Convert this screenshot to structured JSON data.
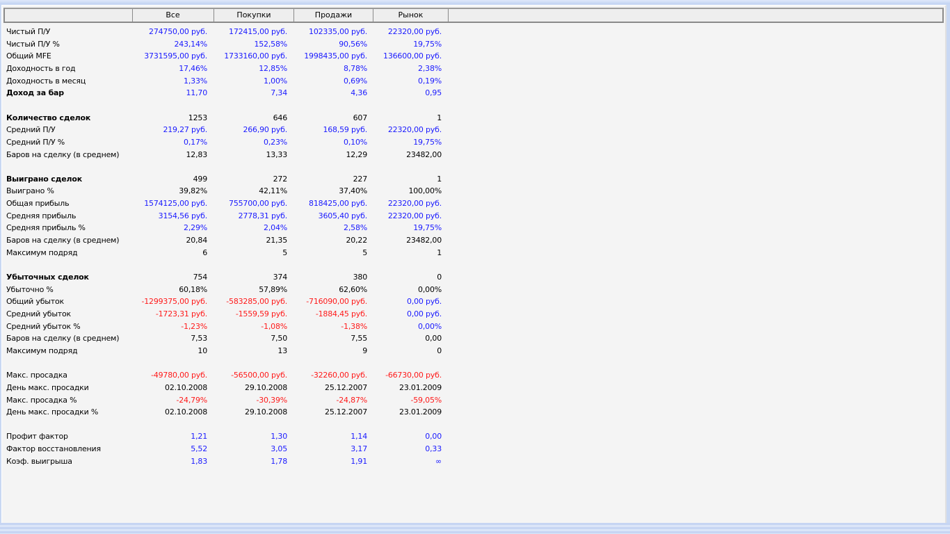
{
  "columns": [
    "Все",
    "Покупки",
    "Продажи",
    "Рынок"
  ],
  "colors": {
    "blue": "#1a1aff",
    "red": "#ff1a1a",
    "black": "#000000"
  },
  "rows": [
    {
      "label": "Чистый П/У",
      "bold": false,
      "color": "blue",
      "values": [
        "274750,00 руб.",
        "172415,00 руб.",
        "102335,00 руб.",
        "22320,00 руб."
      ]
    },
    {
      "label": "Чистый П/У %",
      "bold": false,
      "color": "blue",
      "values": [
        "243,14%",
        "152,58%",
        "90,56%",
        "19,75%"
      ]
    },
    {
      "label": "Общий MFE",
      "bold": false,
      "color": "blue",
      "values": [
        "3731595,00 руб.",
        "1733160,00 руб.",
        "1998435,00 руб.",
        "136600,00 руб."
      ]
    },
    {
      "label": "Доходность в год",
      "bold": false,
      "color": "blue",
      "values": [
        "17,46%",
        "12,85%",
        "8,78%",
        "2,38%"
      ]
    },
    {
      "label": "Доходность в месяц",
      "bold": false,
      "color": "blue",
      "values": [
        "1,33%",
        "1,00%",
        "0,69%",
        "0,19%"
      ]
    },
    {
      "label": "Доход за бар",
      "bold": true,
      "color": "blue",
      "values": [
        "11,70",
        "7,34",
        "4,36",
        "0,95"
      ]
    },
    null,
    {
      "label": "Количество сделок",
      "bold": true,
      "color": "black",
      "values": [
        "1253",
        "646",
        "607",
        "1"
      ]
    },
    {
      "label": "Средний П/У",
      "bold": false,
      "color": "blue",
      "values": [
        "219,27 руб.",
        "266,90 руб.",
        "168,59 руб.",
        "22320,00 руб."
      ]
    },
    {
      "label": "Средний П/У %",
      "bold": false,
      "color": "blue",
      "values": [
        "0,17%",
        "0,23%",
        "0,10%",
        "19,75%"
      ]
    },
    {
      "label": "Баров на сделку (в среднем)",
      "bold": false,
      "color": "black",
      "values": [
        "12,83",
        "13,33",
        "12,29",
        "23482,00"
      ]
    },
    null,
    {
      "label": "Выиграно сделок",
      "bold": true,
      "color": "black",
      "values": [
        "499",
        "272",
        "227",
        "1"
      ]
    },
    {
      "label": "Выиграно %",
      "bold": false,
      "color": "black",
      "values": [
        "39,82%",
        "42,11%",
        "37,40%",
        "100,00%"
      ]
    },
    {
      "label": "Общая прибыль",
      "bold": false,
      "color": "blue",
      "values": [
        "1574125,00 руб.",
        "755700,00 руб.",
        "818425,00 руб.",
        "22320,00 руб."
      ]
    },
    {
      "label": "Средняя прибыль",
      "bold": false,
      "color": "blue",
      "values": [
        "3154,56 руб.",
        "2778,31 руб.",
        "3605,40 руб.",
        "22320,00 руб."
      ]
    },
    {
      "label": "Средняя прибыль %",
      "bold": false,
      "color": "blue",
      "values": [
        "2,29%",
        "2,04%",
        "2,58%",
        "19,75%"
      ]
    },
    {
      "label": "Баров на сделку (в среднем)",
      "bold": false,
      "color": "black",
      "values": [
        "20,84",
        "21,35",
        "20,22",
        "23482,00"
      ]
    },
    {
      "label": "Максимум подряд",
      "bold": false,
      "color": "black",
      "values": [
        "6",
        "5",
        "5",
        "1"
      ]
    },
    null,
    {
      "label": "Убыточных сделок",
      "bold": true,
      "color": "black",
      "values": [
        "754",
        "374",
        "380",
        "0"
      ]
    },
    {
      "label": "Убыточно %",
      "bold": false,
      "color": "black",
      "values": [
        "60,18%",
        "57,89%",
        "62,60%",
        "0,00%"
      ]
    },
    {
      "label": "Общий убыток",
      "bold": false,
      "color": "red",
      "colors": [
        "red",
        "red",
        "red",
        "blue"
      ],
      "values": [
        "-1299375,00 руб.",
        "-583285,00 руб.",
        "-716090,00 руб.",
        "0,00 руб."
      ]
    },
    {
      "label": "Средний убыток",
      "bold": false,
      "color": "red",
      "colors": [
        "red",
        "red",
        "red",
        "blue"
      ],
      "values": [
        "-1723,31 руб.",
        "-1559,59 руб.",
        "-1884,45 руб.",
        "0,00 руб."
      ]
    },
    {
      "label": "Средний убыток %",
      "bold": false,
      "color": "red",
      "colors": [
        "red",
        "red",
        "red",
        "blue"
      ],
      "values": [
        "-1,23%",
        "-1,08%",
        "-1,38%",
        "0,00%"
      ]
    },
    {
      "label": "Баров на сделку (в среднем)",
      "bold": false,
      "color": "black",
      "values": [
        "7,53",
        "7,50",
        "7,55",
        "0,00"
      ]
    },
    {
      "label": "Максимум подряд",
      "bold": false,
      "color": "black",
      "values": [
        "10",
        "13",
        "9",
        "0"
      ]
    },
    null,
    {
      "label": "Макс. просадка",
      "bold": false,
      "color": "red",
      "values": [
        "-49780,00 руб.",
        "-56500,00 руб.",
        "-32260,00 руб.",
        "-66730,00 руб."
      ]
    },
    {
      "label": "День макс. просадки",
      "bold": false,
      "color": "black",
      "values": [
        "02.10.2008",
        "29.10.2008",
        "25.12.2007",
        "23.01.2009"
      ]
    },
    {
      "label": "Макс. просадка %",
      "bold": false,
      "color": "red",
      "values": [
        "-24,79%",
        "-30,39%",
        "-24,87%",
        "-59,05%"
      ]
    },
    {
      "label": "День макс. просадки %",
      "bold": false,
      "color": "black",
      "values": [
        "02.10.2008",
        "29.10.2008",
        "25.12.2007",
        "23.01.2009"
      ]
    },
    null,
    {
      "label": "Профит фактор",
      "bold": false,
      "color": "blue",
      "values": [
        "1,21",
        "1,30",
        "1,14",
        "0,00"
      ]
    },
    {
      "label": "Фактор восстановления",
      "bold": false,
      "color": "blue",
      "values": [
        "5,52",
        "3,05",
        "3,17",
        "0,33"
      ]
    },
    {
      "label": "Коэф. выигрыша",
      "bold": false,
      "color": "blue",
      "values": [
        "1,83",
        "1,78",
        "1,91",
        "∞"
      ]
    }
  ]
}
